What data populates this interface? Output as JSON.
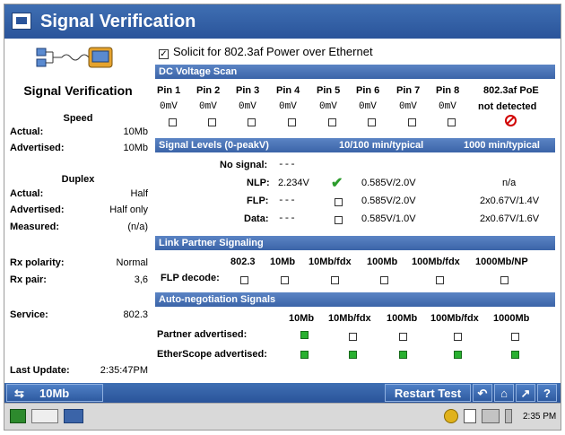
{
  "window": {
    "title": "Signal Verification"
  },
  "left": {
    "title": "Signal Verification",
    "speed": {
      "heading": "Speed",
      "actual_label": "Actual:",
      "actual": "10Mb",
      "advertised_label": "Advertised:",
      "advertised": "10Mb"
    },
    "duplex": {
      "heading": "Duplex",
      "actual_label": "Actual:",
      "actual": "Half",
      "advertised_label": "Advertised:",
      "advertised": "Half only",
      "measured_label": "Measured:",
      "measured": "(n/a)"
    },
    "rx_polarity_label": "Rx polarity:",
    "rx_polarity": "Normal",
    "rx_pair_label": "Rx pair:",
    "rx_pair": "3,6",
    "service_label": "Service:",
    "service": "802.3",
    "last_update_label": "Last Update:",
    "last_update": "2:35:47PM"
  },
  "solicit": {
    "checked": true,
    "check_glyph": "✓",
    "label": "Solicit for 802.3af Power over Ethernet"
  },
  "dc": {
    "header": "DC Voltage Scan",
    "pins": [
      {
        "label": "Pin 1",
        "value": "0mV"
      },
      {
        "label": "Pin 2",
        "value": "0mV"
      },
      {
        "label": "Pin 3",
        "value": "0mV"
      },
      {
        "label": "Pin 4",
        "value": "0mV"
      },
      {
        "label": "Pin 5",
        "value": "0mV"
      },
      {
        "label": "Pin 6",
        "value": "0mV"
      },
      {
        "label": "Pin 7",
        "value": "0mV"
      },
      {
        "label": "Pin 8",
        "value": "0mV"
      }
    ],
    "poe_label": "802.3af PoE",
    "poe_value": "not detected"
  },
  "signal": {
    "header": "Signal Levels (0-peakV)",
    "col_10_100": "10/100 min/typical",
    "col_1000": "1000 min/typical",
    "no_signal_label": "No signal:",
    "no_signal_value": "---",
    "rows": [
      {
        "label": "NLP:",
        "value": "2.234V",
        "typ": "0.585V/2.0V",
        "gig": "n/a"
      },
      {
        "label": "FLP:",
        "value": "---",
        "typ": "0.585V/2.0V",
        "gig": "2x0.67V/1.4V"
      },
      {
        "label": "Data:",
        "value": "---",
        "typ": "0.585V/1.0V",
        "gig": "2x0.67V/1.6V"
      }
    ]
  },
  "link": {
    "header": "Link Partner Signaling",
    "cols": [
      "802.3",
      "10Mb",
      "10Mb/fdx",
      "100Mb",
      "100Mb/fdx",
      "1000Mb/NP"
    ],
    "flp_decode_label": "FLP decode:"
  },
  "auto": {
    "header": "Auto-negotiation Signals",
    "cols": [
      "10Mb",
      "10Mb/fdx",
      "100Mb",
      "100Mb/fdx",
      "1000Mb"
    ],
    "partner_label": "Partner advertised:",
    "partner": [
      true,
      false,
      false,
      false,
      false
    ],
    "etherscope_label": "EtherScope advertised:",
    "etherscope": [
      true,
      true,
      true,
      true,
      true
    ]
  },
  "bottom": {
    "speed_button": "10Mb",
    "speed_icon": "link-speed-icon",
    "restart_button": "Restart Test",
    "help_button": "?"
  },
  "taskbar": {
    "time": "2:35 PM"
  },
  "colors": {
    "bar": "#2a549a",
    "band": "#4a74b8",
    "green": "#29b030",
    "no_sign": "#d10000"
  }
}
